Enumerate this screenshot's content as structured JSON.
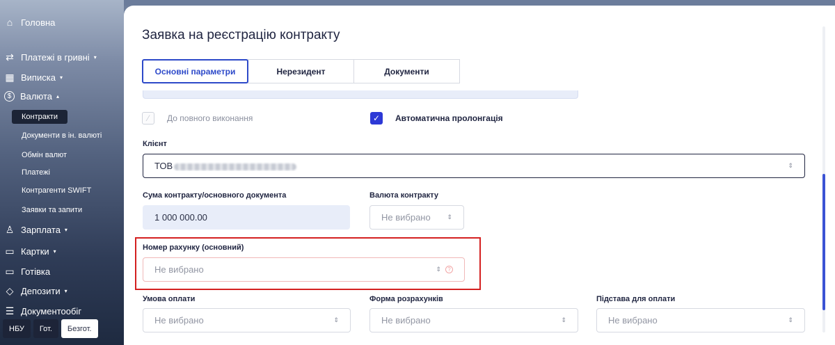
{
  "sidebar": {
    "items": [
      {
        "label": "Головна",
        "icon": "home-icon",
        "glyph": "⌂",
        "caret": ""
      },
      {
        "label": "Платежі в гривні",
        "icon": "transfer-icon",
        "glyph": "⇄",
        "caret": "▾"
      },
      {
        "label": "Виписка",
        "icon": "statement-icon",
        "glyph": "▦",
        "caret": "▾"
      },
      {
        "label": "Валюта",
        "icon": "currency-icon",
        "glyph": "$",
        "caret": "▴"
      },
      {
        "label": "Зарплата",
        "icon": "people-icon",
        "glyph": "♙",
        "caret": "▾"
      },
      {
        "label": "Картки",
        "icon": "card-icon",
        "glyph": "▭",
        "caret": "▾"
      },
      {
        "label": "Готівка",
        "icon": "cash-icon",
        "glyph": "▭",
        "caret": ""
      },
      {
        "label": "Депозити",
        "icon": "deposit-icon",
        "glyph": "◇",
        "caret": "▾"
      },
      {
        "label": "Документообіг",
        "icon": "document-icon",
        "glyph": "☰",
        "caret": ""
      }
    ],
    "sub_items": [
      {
        "label": "Контракти",
        "active": true
      },
      {
        "label": "Документи в ін. валюті",
        "active": false
      },
      {
        "label": "Обмін валют",
        "active": false
      },
      {
        "label": "Платежі",
        "active": false
      },
      {
        "label": "Контрагенти SWIFT",
        "active": false
      },
      {
        "label": "Заявки та запити",
        "active": false
      }
    ],
    "bottom_tabs": [
      "НБУ",
      "Гот.",
      "Безгот."
    ]
  },
  "page": {
    "title": "Заявка на реєстрацію контракту",
    "tabs": [
      "Основні параметри",
      "Нерезидент",
      "Документи"
    ],
    "checks": {
      "full_execution": {
        "label": "До повного виконання",
        "checked": false
      },
      "auto_prolongation": {
        "label": "Автоматична пролонгація",
        "checked": true,
        "mark": "✓"
      }
    },
    "client": {
      "label": "Клієнт",
      "value_prefix": "ТОВ"
    },
    "contract_sum": {
      "label": "Сума контракту/основного документа",
      "value": "1 000 000.00"
    },
    "contract_currency": {
      "label": "Валюта контракту",
      "placeholder": "Не вибрано"
    },
    "account_number": {
      "label": "Номер рахунку (основний)",
      "placeholder": "Не вибрано",
      "error_icon": "?"
    },
    "payment_condition": {
      "label": "Умова оплати",
      "placeholder": "Не вибрано"
    },
    "settlement_form": {
      "label": "Форма розрахунків",
      "placeholder": "Не вибрано"
    },
    "payment_basis": {
      "label": "Підстава для оплати",
      "placeholder": "Не вибрано"
    },
    "select_arrows": "⇕"
  },
  "colors": {
    "accent": "#2d49c9",
    "error_outline": "#d42020",
    "sidebar_active": "#1c2436"
  }
}
